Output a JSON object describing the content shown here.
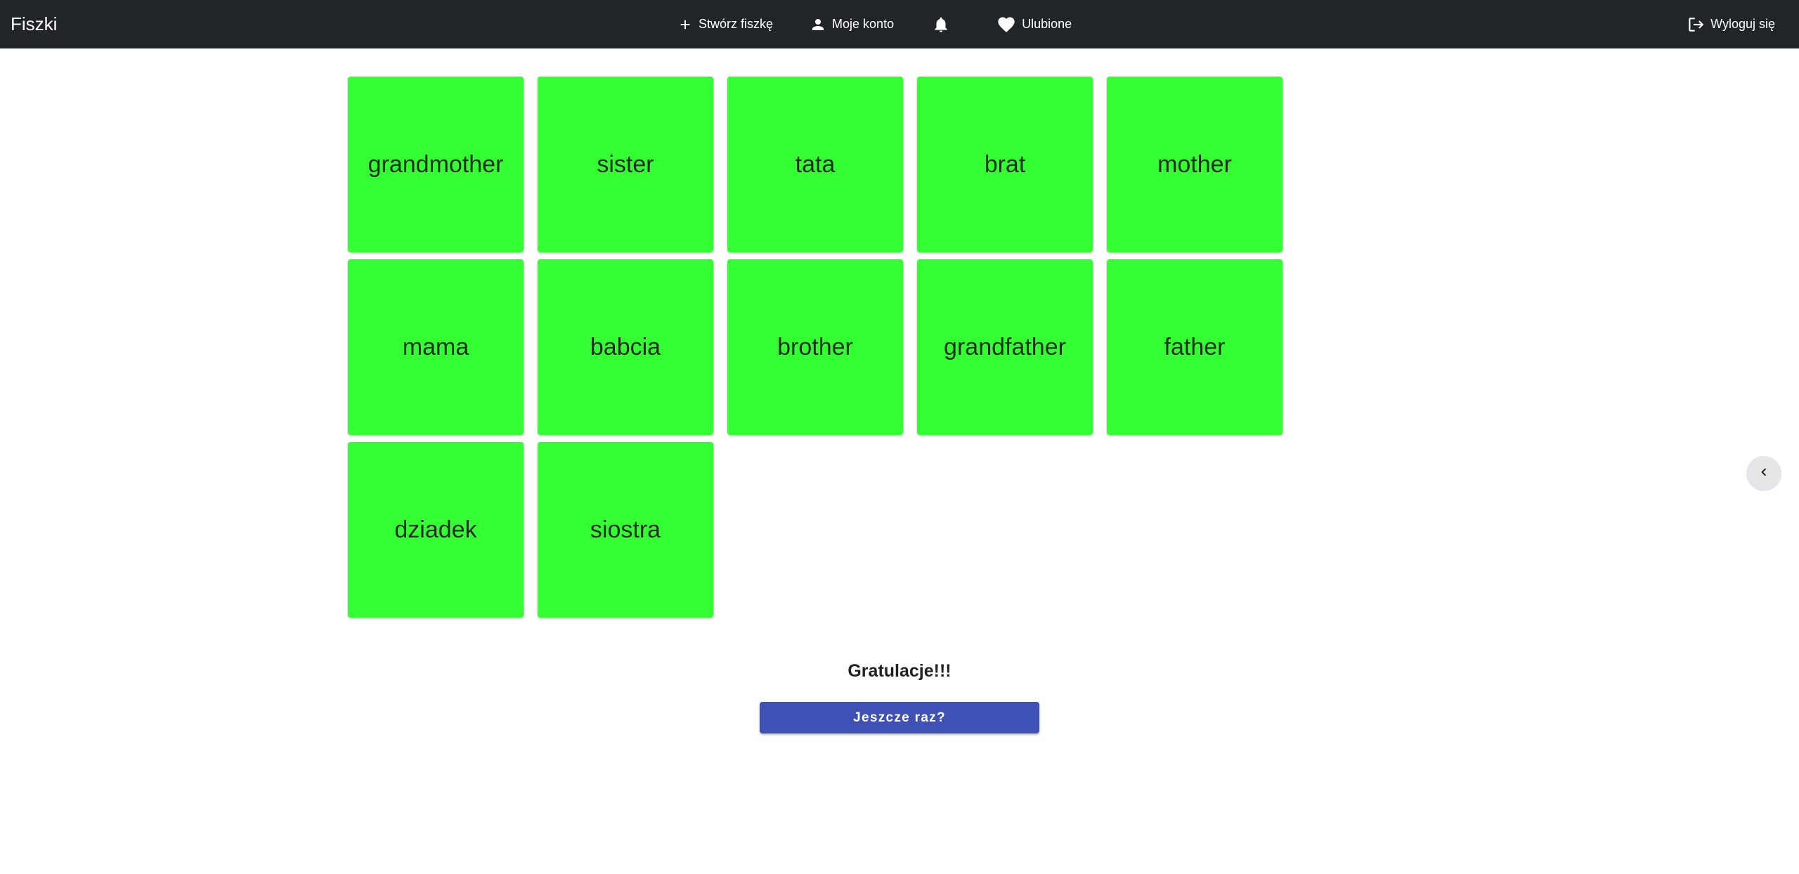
{
  "navbar": {
    "brand": "Fiszki",
    "create_label": "Stwórz fiszkę",
    "account_label": "Moje konto",
    "favorites_label": "Ulubione",
    "logout_label": "Wyloguj się"
  },
  "cards": [
    "grandmother",
    "sister",
    "tata",
    "brat",
    "mother",
    "mama",
    "babcia",
    "brother",
    "grandfather",
    "father",
    "dziadek",
    "siostra"
  ],
  "result": {
    "message": "Gratulacje!!!",
    "retry_label": "Jeszcze raz?"
  },
  "colors": {
    "navbar_bg": "#212529",
    "card_bg": "#33ff33",
    "button_bg": "#3f51b5"
  },
  "icons": {
    "create": "plus-icon",
    "account": "person-icon",
    "notifications": "bell-icon",
    "favorites": "heart-icon",
    "logout": "logout-icon",
    "side_toggle": "chevron-left-icon"
  }
}
